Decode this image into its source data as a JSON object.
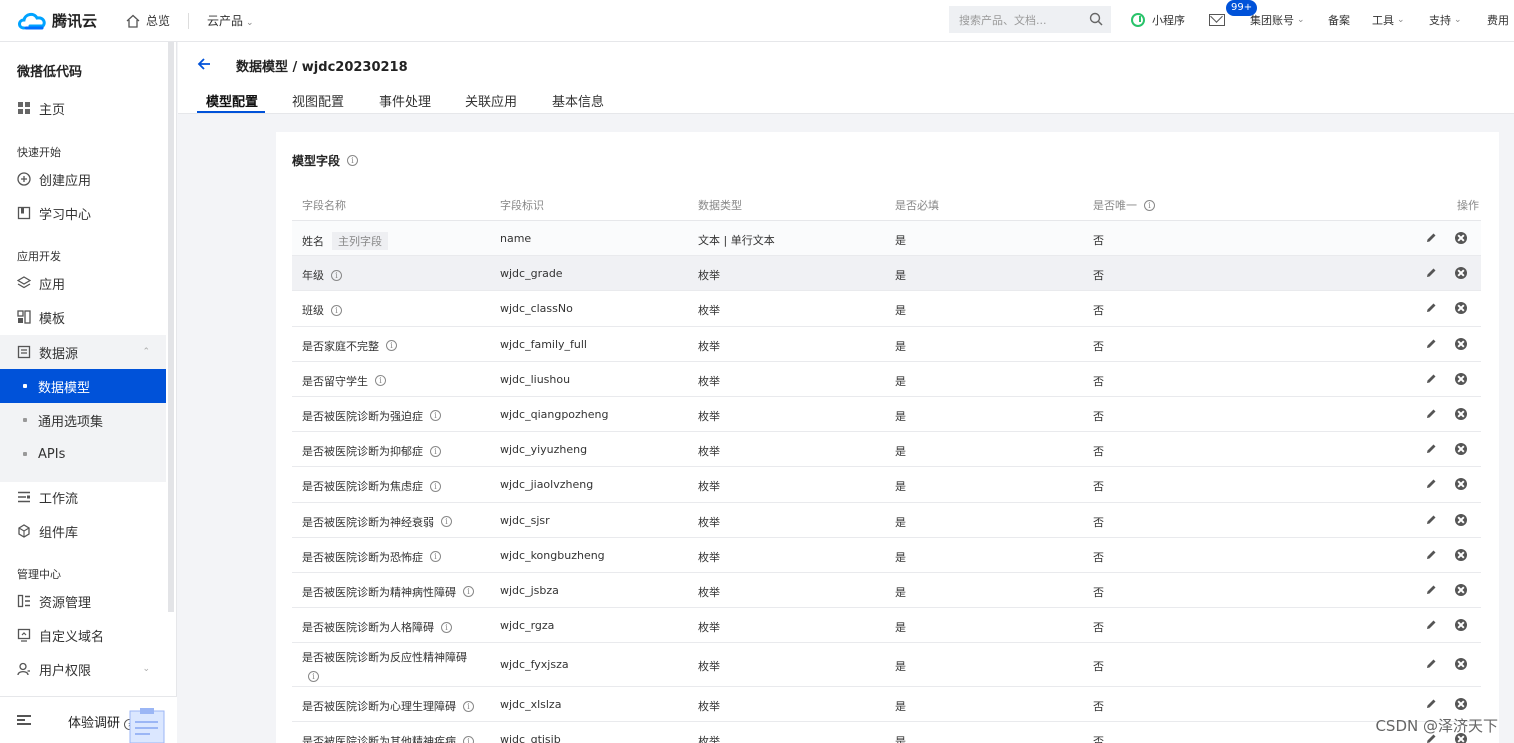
{
  "topbar": {
    "brand": "腾讯云",
    "home": "总览",
    "products": "云产品",
    "search_placeholder": "搜索产品、文档...",
    "mini_program": "小程序",
    "mail_badge": "99+",
    "account": "集团账号",
    "record": "备案",
    "tools": "工具",
    "support": "支持",
    "billing": "费用"
  },
  "sidebar": {
    "title": "微搭低代码",
    "home": "主页",
    "group_quick": "快速开始",
    "create_app": "创建应用",
    "learn": "学习中心",
    "group_dev": "应用开发",
    "apps": "应用",
    "templates": "模板",
    "datasource": "数据源",
    "sub": [
      "数据模型",
      "通用选项集",
      "APIs"
    ],
    "workflow": "工作流",
    "components": "组件库",
    "group_admin": "管理中心",
    "resource": "资源管理",
    "domain": "自定义域名",
    "permission": "用户权限",
    "survey": "体验调研"
  },
  "header": {
    "breadcrumb": "数据模型 / wjdc20230218",
    "tabs": [
      "模型配置",
      "视图配置",
      "事件处理",
      "关联应用",
      "基本信息"
    ]
  },
  "card": {
    "title": "模型字段",
    "columns": [
      "字段名称",
      "字段标识",
      "数据类型",
      "是否必填",
      "是否唯一",
      "操作"
    ],
    "primary_tag": "主列字段",
    "rows": [
      {
        "name": "姓名",
        "key": "name",
        "type": "文本 | 单行文本",
        "required": "是",
        "unique": "否"
      },
      {
        "name": "年级",
        "key": "wjdc_grade",
        "type": "枚举",
        "required": "是",
        "unique": "否"
      },
      {
        "name": "班级",
        "key": "wjdc_classNo",
        "type": "枚举",
        "required": "是",
        "unique": "否"
      },
      {
        "name": "是否家庭不完整",
        "key": "wjdc_family_full",
        "type": "枚举",
        "required": "是",
        "unique": "否"
      },
      {
        "name": "是否留守学生",
        "key": "wjdc_liushou",
        "type": "枚举",
        "required": "是",
        "unique": "否"
      },
      {
        "name": "是否被医院诊断为强迫症",
        "key": "wjdc_qiangpozheng",
        "type": "枚举",
        "required": "是",
        "unique": "否"
      },
      {
        "name": "是否被医院诊断为抑郁症",
        "key": "wjdc_yiyuzheng",
        "type": "枚举",
        "required": "是",
        "unique": "否"
      },
      {
        "name": "是否被医院诊断为焦虑症",
        "key": "wjdc_jiaolvzheng",
        "type": "枚举",
        "required": "是",
        "unique": "否"
      },
      {
        "name": "是否被医院诊断为神经衰弱",
        "key": "wjdc_sjsr",
        "type": "枚举",
        "required": "是",
        "unique": "否"
      },
      {
        "name": "是否被医院诊断为恐怖症",
        "key": "wjdc_kongbuzheng",
        "type": "枚举",
        "required": "是",
        "unique": "否"
      },
      {
        "name": "是否被医院诊断为精神病性障碍",
        "key": "wjdc_jsbza",
        "type": "枚举",
        "required": "是",
        "unique": "否"
      },
      {
        "name": "是否被医院诊断为人格障碍",
        "key": "wjdc_rgza",
        "type": "枚举",
        "required": "是",
        "unique": "否"
      },
      {
        "name": "是否被医院诊断为反应性精神障碍",
        "key": "wjdc_fyxjsza",
        "type": "枚举",
        "required": "是",
        "unique": "否"
      },
      {
        "name": "是否被医院诊断为心理生理障碍",
        "key": "wjdc_xlslza",
        "type": "枚举",
        "required": "是",
        "unique": "否"
      },
      {
        "name": "是否被医院诊断为其他精神疾病",
        "key": "wjdc_qtjsjb",
        "type": "枚举",
        "required": "是",
        "unique": "否"
      }
    ]
  },
  "watermark": "CSDN @泽济天下"
}
